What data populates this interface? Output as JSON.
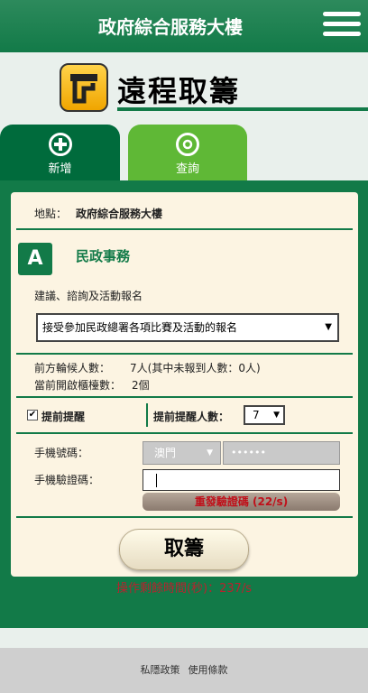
{
  "header": {
    "title": "政府綜合服務大樓",
    "menu_icon": "hamburger-menu-icon"
  },
  "page": {
    "title": "遠程取籌",
    "icon": "queue-ticket-icon"
  },
  "tabs": [
    {
      "label": "新增",
      "icon": "plus-icon",
      "active": true
    },
    {
      "label": "查詢",
      "icon": "location-pin-icon",
      "active": false
    }
  ],
  "location": {
    "label": "地點：",
    "value": "政府綜合服務大樓"
  },
  "service": {
    "badge": "A",
    "name": "民政事務",
    "category": "建議、諮詢及活動報名"
  },
  "service_select": {
    "selected": "接受參加民政總署各項比賽及活動的報名"
  },
  "queue": {
    "waiting_label": "前方輪候人數：",
    "waiting_value": "7人(其中未報到人數：0人)",
    "counters_label": "當前開啟櫃檯數：",
    "counters_value": "2個"
  },
  "reminder": {
    "label": "提前提醒",
    "checked": true,
    "count_label": "提前提醒人數：",
    "count_value": "7"
  },
  "phone": {
    "label": "手機號碼：",
    "region": "澳門",
    "number": "••••••"
  },
  "verify": {
    "label": "手機驗證碼：",
    "resend_label": "重發驗證碼 (22/s)"
  },
  "cancel_label": "取籌",
  "remaining": "操作剩餘時間(秒)：237/s",
  "footer": {
    "privacy": "私隱政策",
    "terms": "使用條款"
  },
  "colors": {
    "brand_green": "#127a48",
    "tab_light_green": "#5fb836",
    "card_bg": "#fcf4e2",
    "alert_red": "#b8222e"
  }
}
